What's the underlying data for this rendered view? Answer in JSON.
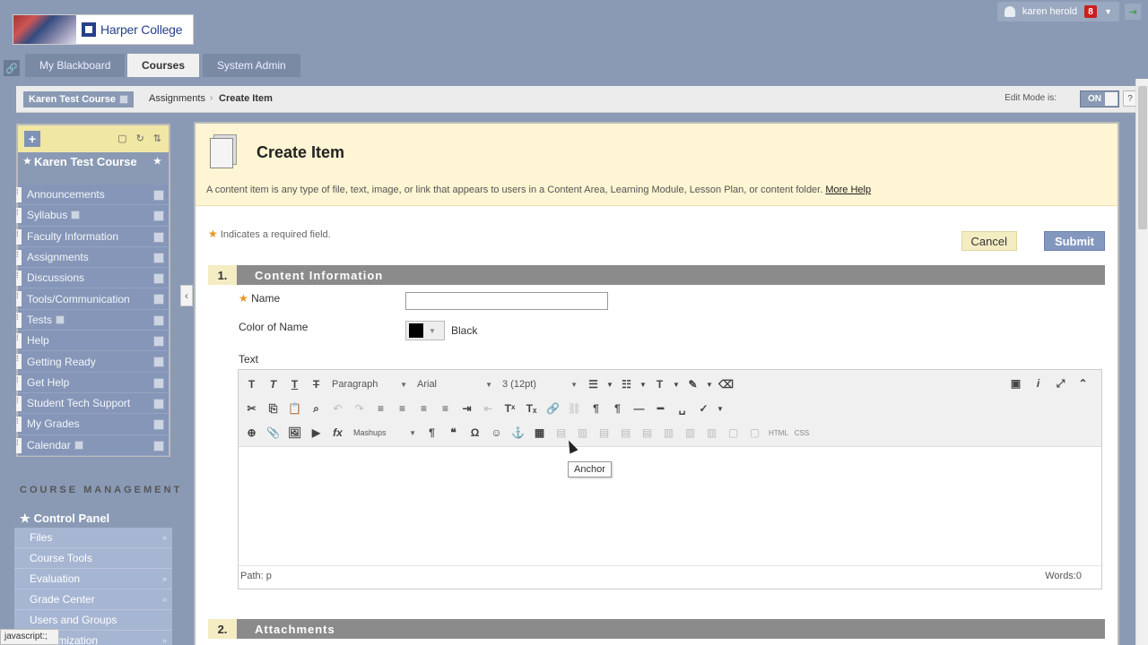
{
  "header": {
    "logo_text": "Harper College",
    "user_name": "karen herold",
    "notification_count": "8"
  },
  "tabs": [
    {
      "label": "My Blackboard"
    },
    {
      "label": "Courses"
    },
    {
      "label": "System Admin"
    }
  ],
  "breadcrumb": {
    "course": "Karen Test Course",
    "items": [
      "Assignments",
      "Create Item"
    ],
    "edit_mode_label": "Edit Mode is:",
    "edit_mode_value": "ON",
    "help_label": "?"
  },
  "course_menu": {
    "title": "Karen Test Course",
    "items": [
      {
        "label": "Announcements"
      },
      {
        "label": "Syllabus"
      },
      {
        "label": "Faculty Information"
      },
      {
        "label": "Assignments"
      },
      {
        "label": "Discussions"
      },
      {
        "label": "Tools/Communication"
      },
      {
        "label": "Tests"
      },
      {
        "label": "Help"
      },
      {
        "label": "Getting Ready"
      },
      {
        "label": "Get Help"
      },
      {
        "label": "Student Tech Support"
      },
      {
        "label": "My Grades"
      },
      {
        "label": "Calendar"
      }
    ]
  },
  "course_management": {
    "heading": "COURSE MANAGEMENT",
    "panel_title": "Control Panel",
    "items": [
      {
        "label": "Files"
      },
      {
        "label": "Course Tools"
      },
      {
        "label": "Evaluation"
      },
      {
        "label": "Grade Center"
      },
      {
        "label": "Users and Groups"
      },
      {
        "label": "Customization"
      }
    ]
  },
  "status_bar": "javascript:;",
  "page": {
    "title": "Create Item",
    "description": "A content item is any type of file, text, image, or link that appears to users in a Content Area, Learning Module, Lesson Plan, or content folder.",
    "more_help": "More Help",
    "required_note": "Indicates a required field.",
    "cancel_label": "Cancel",
    "submit_label": "Submit"
  },
  "section1": {
    "number": "1.",
    "title": "Content Information",
    "name_label": "Name",
    "name_value": "",
    "color_label": "Color of Name",
    "color_value": "Black",
    "color_hex": "#000000",
    "text_label": "Text"
  },
  "editor": {
    "block_format": "Paragraph",
    "font_family": "Arial",
    "font_size": "3 (12pt)",
    "mashups_label": "Mashups",
    "html_label": "HTML",
    "css_label": "CSS",
    "tooltip": "Anchor",
    "path_label": "Path: p",
    "words_label": "Words:0"
  },
  "section2": {
    "number": "2.",
    "title": "Attachments"
  },
  "colors": {
    "header_bg": "#8a9ab5",
    "menu_bg": "#8596b8",
    "accent_yellow": "#fdf5d3",
    "submit_bg": "#8397bf"
  }
}
